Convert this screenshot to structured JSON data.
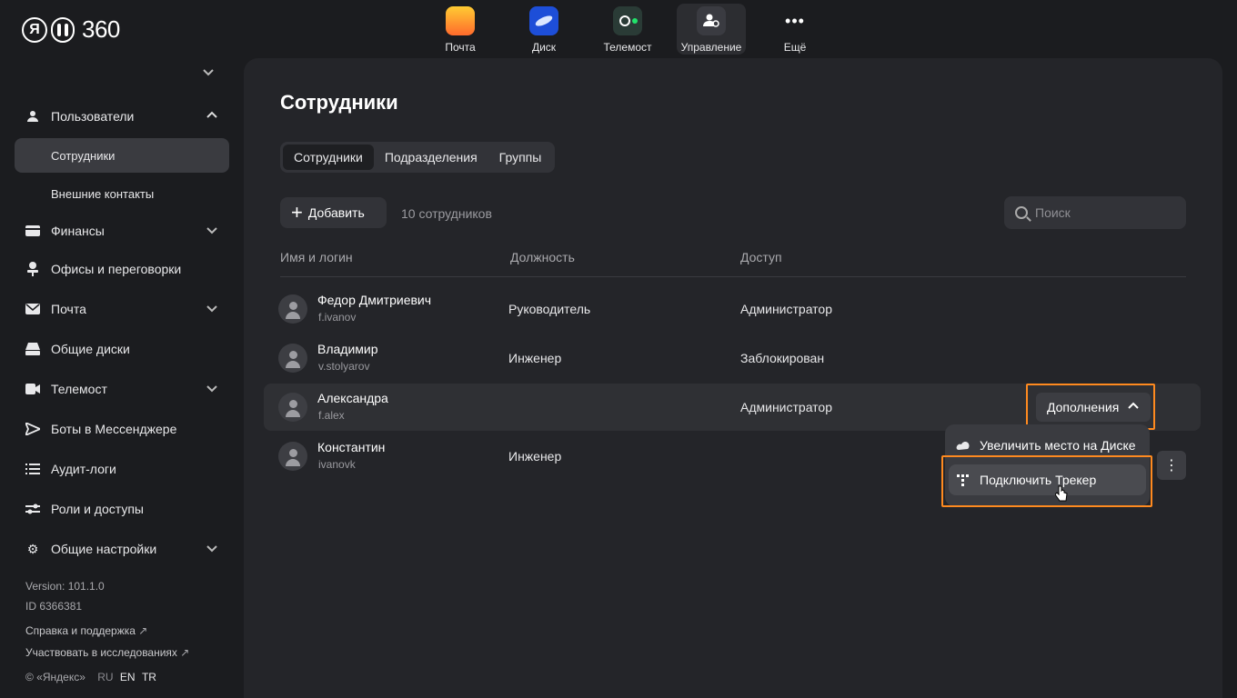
{
  "logo": {
    "ya": "Я",
    "num": "360"
  },
  "apps": [
    {
      "label": "Почта",
      "icon": "mail-icon"
    },
    {
      "label": "Диск",
      "icon": "disk-icon"
    },
    {
      "label": "Телемост",
      "icon": "telemost-icon"
    },
    {
      "label": "Управление",
      "icon": "management-icon",
      "active": true
    },
    {
      "label": "Ещё",
      "icon": "more-dots-icon"
    }
  ],
  "sidebar": {
    "items": [
      {
        "label": "Пользователи",
        "icon": "user-icon",
        "expanded": true
      },
      {
        "label": "Сотрудники",
        "sub": true,
        "active": true
      },
      {
        "label": "Внешние контакты",
        "sub": true
      },
      {
        "label": "Финансы",
        "icon": "card-icon"
      },
      {
        "label": "Офисы и переговорки",
        "icon": "chair-icon"
      },
      {
        "label": "Почта",
        "icon": "envelope-icon"
      },
      {
        "label": "Общие диски",
        "icon": "drive-icon"
      },
      {
        "label": "Телемост",
        "icon": "camera-icon"
      },
      {
        "label": "Боты в Мессенджере",
        "icon": "send-icon"
      },
      {
        "label": "Аудит-логи",
        "icon": "list-icon"
      },
      {
        "label": "Роли и доступы",
        "icon": "sliders-icon"
      },
      {
        "label": "Общие настройки",
        "icon": "gear-icon"
      }
    ],
    "version": "Version: 101.1.0",
    "id": "ID 6366381",
    "help": "Справка и поддержка",
    "research": "Участвовать в исследованиях",
    "copyright": "© «Яндекс»",
    "langs": [
      "RU",
      "EN",
      "TR"
    ]
  },
  "main": {
    "title": "Сотрудники",
    "tabs": [
      "Сотрудники",
      "Подразделения",
      "Группы"
    ],
    "add_label": "Добавить",
    "count": "10 сотрудников",
    "search_placeholder": "Поиск",
    "columns": [
      "Имя и логин",
      "Должность",
      "Доступ"
    ],
    "rows": [
      {
        "name": "Федор Дмитриевич",
        "login": "f.ivanov",
        "position": "Руководитель",
        "access": "Администратор"
      },
      {
        "name": "Владимир",
        "login": "v.stolyarov",
        "position": "Инженер",
        "access": "Заблокирован"
      },
      {
        "name": "Александра",
        "login": "f.alex",
        "position": "",
        "access": "Администратор"
      },
      {
        "name": "Константин",
        "login": "ivanovk",
        "position": "Инженер",
        "access": ""
      }
    ],
    "addons_label": "Дополнения",
    "menu": [
      "Увеличить место на Диске",
      "Подключить Трекер"
    ]
  },
  "colors": {
    "highlight": "#ff8a1f",
    "background": "#1b1c1f",
    "panel": "#242529"
  }
}
